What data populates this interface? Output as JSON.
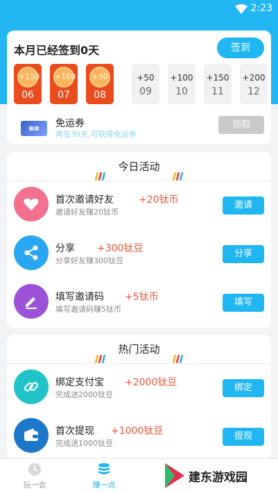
{
  "status_bar": {
    "time": "2:23"
  },
  "checkin": {
    "title": "本月已经签到0天",
    "button": "签到",
    "days": [
      {
        "points": "+150",
        "day": "06",
        "signed": true
      },
      {
        "points": "+100",
        "day": "07",
        "signed": true
      },
      {
        "points": "+50",
        "day": "08",
        "signed": true
      },
      {
        "points": "+50",
        "day": "09",
        "signed": false
      },
      {
        "points": "+100",
        "day": "10",
        "signed": false
      },
      {
        "points": "+150",
        "day": "11",
        "signed": false
      },
      {
        "points": "+200",
        "day": "12",
        "signed": false
      }
    ],
    "coupon": {
      "name": "免运券",
      "desc": "再签30天,可获得免运券",
      "button": "领取"
    }
  },
  "today": {
    "title": "今日活动",
    "items": [
      {
        "name": "首次邀请好友",
        "reward": "+20钛币",
        "desc": "邀请好友赚20钛币",
        "button": "邀请",
        "icon": "heart-icon",
        "color": "#f3708f"
      },
      {
        "name": "分享",
        "reward": "+300钛豆",
        "desc": "分享好友赚300钛豆",
        "button": "分享",
        "icon": "share-icon",
        "color": "#29a7f2"
      },
      {
        "name": "填写邀请码",
        "reward": "+5钛币",
        "desc": "填写邀请码赚5钛币",
        "button": "填写",
        "icon": "pen-icon",
        "color": "#9b52d9"
      }
    ]
  },
  "hot": {
    "title": "热门活动",
    "items": [
      {
        "name": "绑定支付宝",
        "reward": "+2000钛豆",
        "desc": "完成送2000钛豆",
        "button": "绑定",
        "icon": "link-icon",
        "color": "#1fc3c8"
      },
      {
        "name": "首次提现",
        "reward": "+1000钛豆",
        "desc": "完成送1000钛豆",
        "button": "提现",
        "icon": "wallet-icon",
        "color": "#1d78c9"
      }
    ]
  },
  "tabs": [
    {
      "label": "玩一会",
      "icon": "clock-icon",
      "active": false
    },
    {
      "label": "赚一点",
      "icon": "coins-icon",
      "active": true
    }
  ],
  "watermark": {
    "text": "建东游戏园"
  },
  "colors": {
    "accent": "#1fb6f1",
    "reward": "#e95838",
    "signed": "#ea4c1d"
  }
}
